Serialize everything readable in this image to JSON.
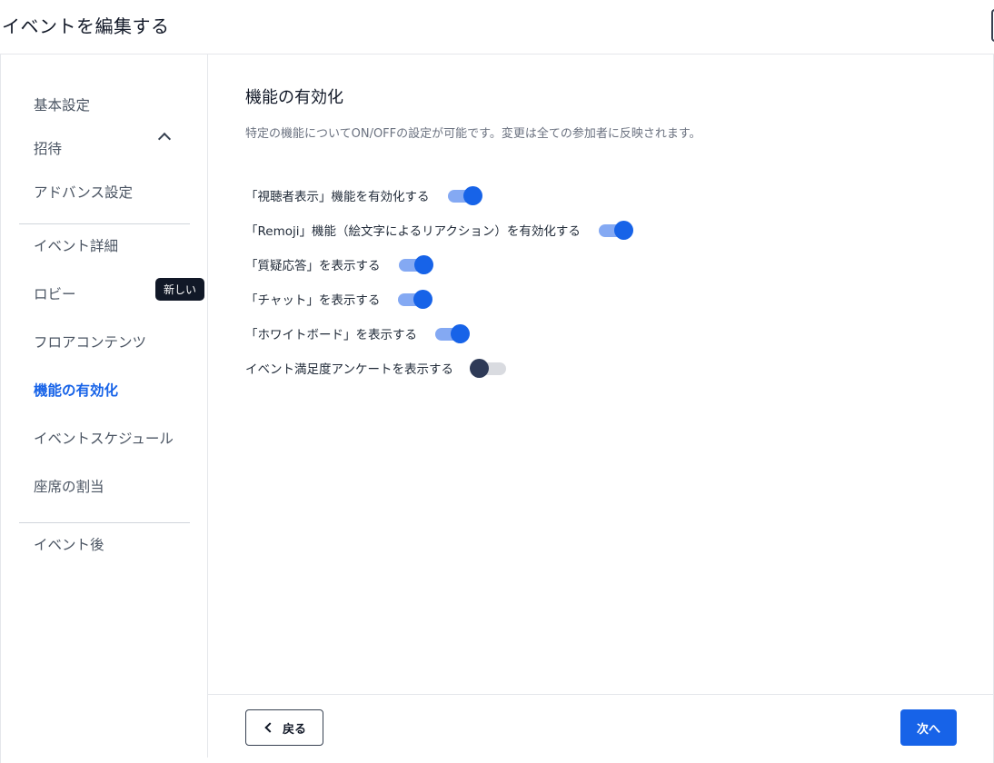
{
  "header": {
    "title": "イベントを編集する"
  },
  "sidebar": {
    "items": [
      {
        "label": "基本設定"
      },
      {
        "label": "招待"
      },
      {
        "label": "アドバンス設定"
      },
      {
        "label": "イベント詳細"
      },
      {
        "label": "ロビー"
      },
      {
        "label": "フロアコンテンツ",
        "badge": "新しい"
      },
      {
        "label": "機能の有効化",
        "active": true
      },
      {
        "label": "イベントスケジュール"
      },
      {
        "label": "座席の割当"
      },
      {
        "label": "イベント後"
      }
    ]
  },
  "main": {
    "title": "機能の有効化",
    "description": "特定の機能についてON/OFFの設定が可能です。変更は全ての参加者に反映されます。",
    "features": [
      {
        "label": "「視聴者表示」機能を有効化する",
        "enabled": true
      },
      {
        "label": "「Remoji」機能（絵文字によるリアクション）を有効化する",
        "enabled": true
      },
      {
        "label": "「質疑応答」を表示する",
        "enabled": true
      },
      {
        "label": "「チャット」を表示する",
        "enabled": true
      },
      {
        "label": "「ホワイトボード」を表示する",
        "enabled": true
      },
      {
        "label": "イベント満足度アンケートを表示する",
        "enabled": false
      }
    ]
  },
  "footer": {
    "back_label": "戻る",
    "next_label": "次へ"
  },
  "colors": {
    "accent": "#1763e8",
    "toggle_off_knob": "#2e3a57"
  }
}
